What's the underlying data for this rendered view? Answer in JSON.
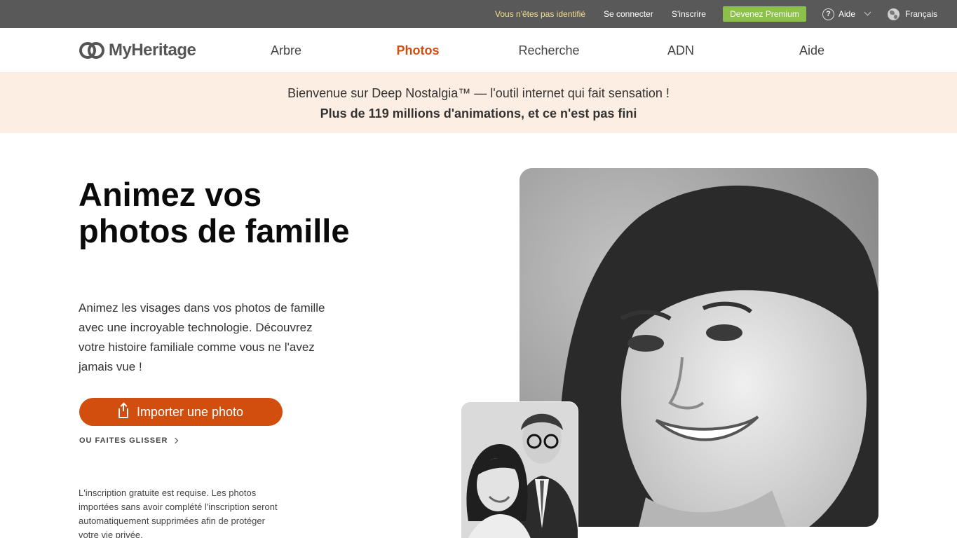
{
  "topbar": {
    "guest": "Vous n'êtes pas identifié",
    "login": "Se connecter",
    "signup": "S'inscrire",
    "premium": "Devenez Premium",
    "help": "Aide",
    "language": "Français"
  },
  "nav": {
    "logo": "MyHeritage",
    "items": [
      "Arbre",
      "Photos",
      "Recherche",
      "ADN",
      "Aide"
    ],
    "active": "Photos"
  },
  "banner": {
    "line1": "Bienvenue sur Deep Nostalgia™ — l'outil internet qui fait sensation !",
    "line2": "Plus de 119 millions d'animations, et ce n'est pas fini"
  },
  "hero": {
    "headline": "Animez vos photos de famille",
    "subtext": "Animez les visages dans vos photos de famille avec une incroyable technologie. Découvrez votre histoire familiale comme vous ne l'avez jamais vue !",
    "upload_label": "Importer une photo",
    "drag_label": "OU FAITES GLISSER",
    "disclaimer": "L'inscription gratuite est requise. Les photos importées sans avoir complété l'inscription seront automatiquement supprimées afin de protéger votre vie privée."
  },
  "colors": {
    "accent": "#d24e0f",
    "premium": "#8bc04a",
    "topbar": "#595959",
    "banner": "#fdeee3"
  }
}
